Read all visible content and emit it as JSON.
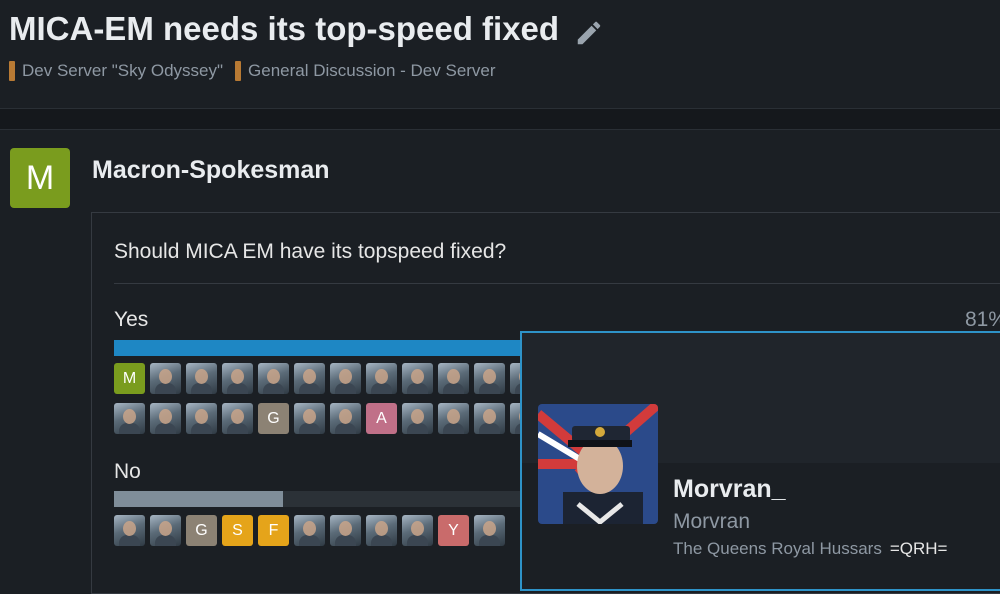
{
  "topic": {
    "title": "MICA-EM needs its top-speed fixed",
    "edit_icon": "pencil-icon",
    "breadcrumbs": [
      "Dev Server \"Sky Odyssey\"",
      "General Discussion - Dev Server"
    ],
    "crumb_color": "#b87a34"
  },
  "post": {
    "author_initial": "M",
    "author": "Macron-Spokesman",
    "avatar_color": "#7a9c1e"
  },
  "poll": {
    "question": "Should MICA EM have its topspeed fixed?",
    "options": [
      {
        "label": "Yes",
        "percent_text": "81%",
        "fill_fraction": 0.81,
        "fill_color": "#1e87c4",
        "voters_row1": [
          "M",
          "img",
          "img",
          "img",
          "img",
          "img",
          "img",
          "img",
          "img",
          "img",
          "img",
          "img"
        ],
        "voters_row1_colors": [
          "#7a9c1e"
        ],
        "voters_row2": [
          "img",
          "img",
          "img",
          "img",
          "G",
          "img",
          "img",
          "A",
          "img",
          "img",
          "img",
          "img"
        ]
      },
      {
        "label": "No",
        "percent_text": "",
        "fill_fraction": 0.19,
        "fill_color": "#7f8d99",
        "voters_row1": [
          "img",
          "img",
          "G",
          "S",
          "F",
          "img",
          "img",
          "img",
          "img",
          "Y",
          "img"
        ]
      }
    ]
  },
  "user_card": {
    "username": "Morvran_",
    "display_name": "Morvran",
    "group": "The Queens Royal Hussars",
    "clan_tag": "=QRH=",
    "border_color": "#2e93c8"
  }
}
